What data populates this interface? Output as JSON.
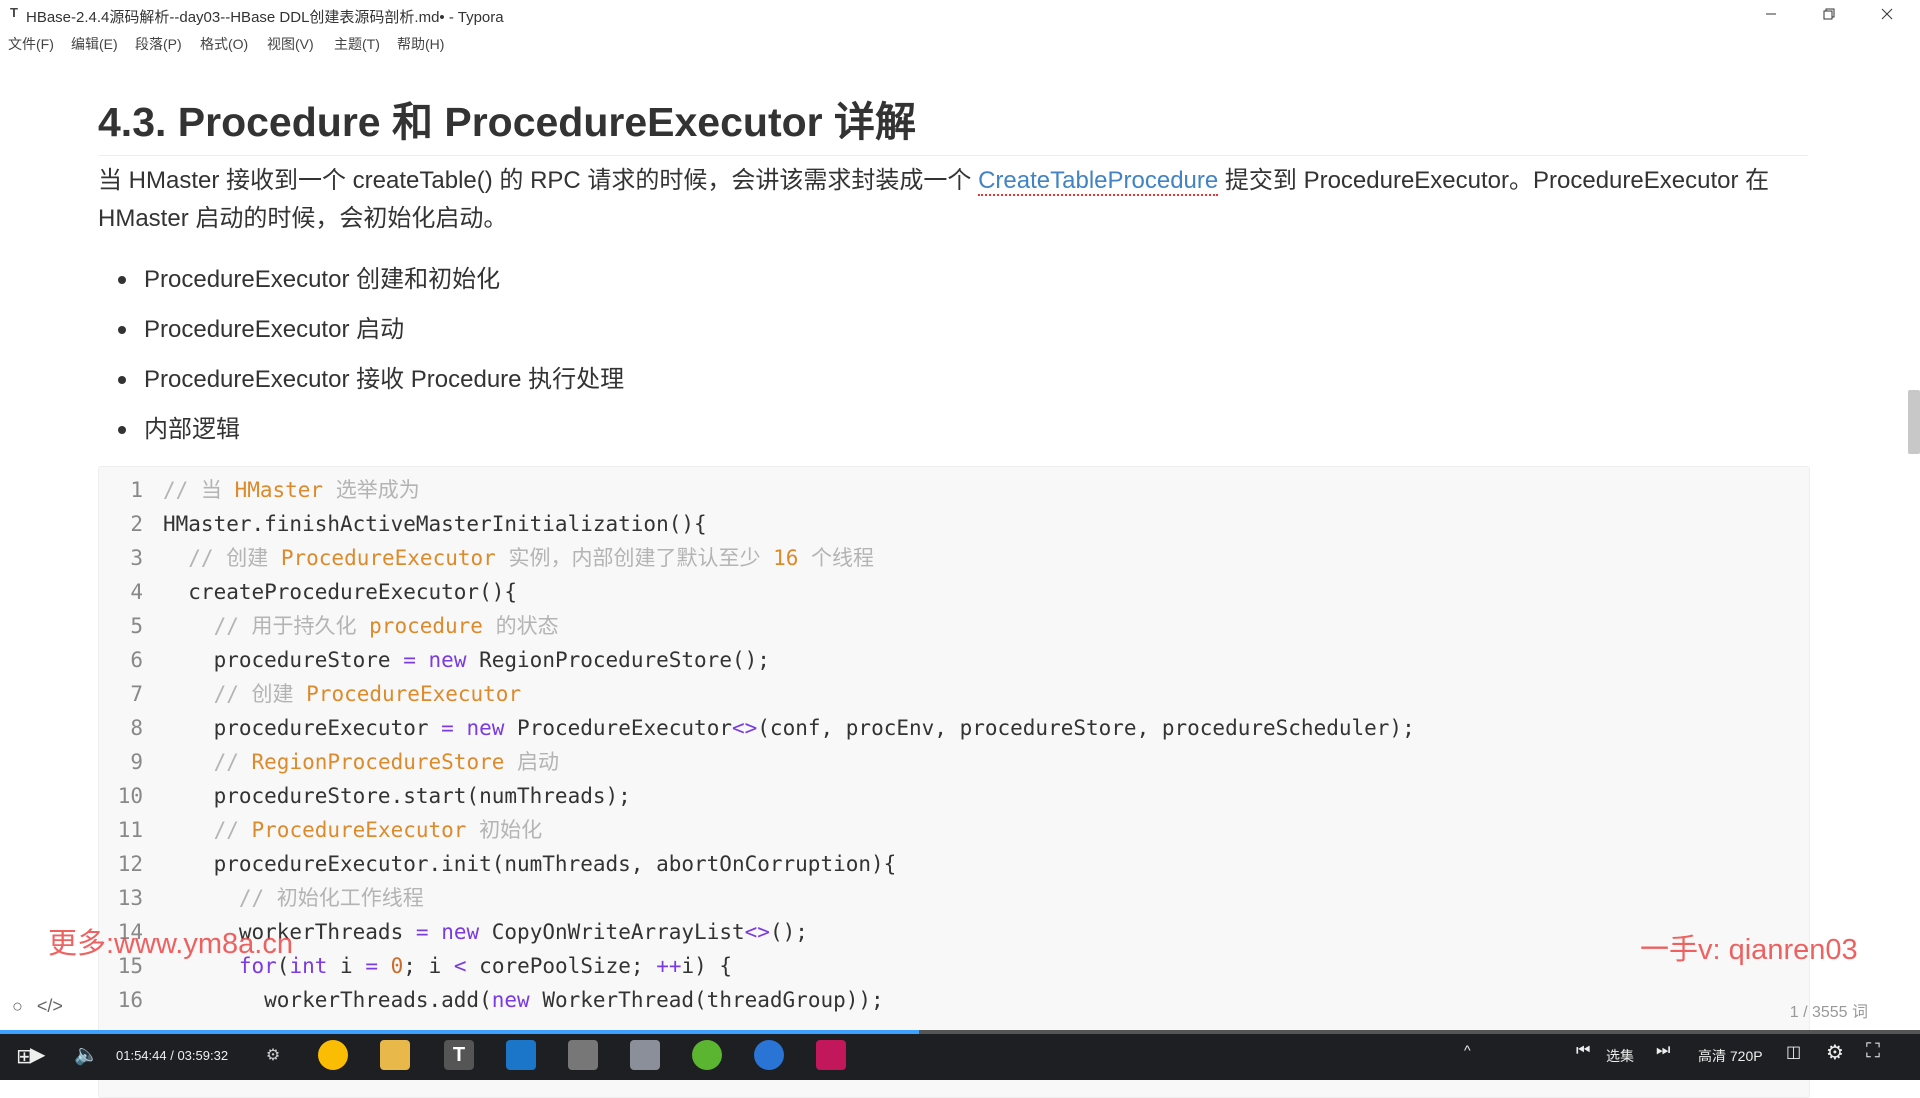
{
  "window": {
    "title": "HBase-2.4.4源码解析--day03--HBase DDL创建表源码剖析.md• - Typora",
    "app_icon": "T"
  },
  "menu": [
    "文件(F)",
    "编辑(E)",
    "段落(P)",
    "格式(O)",
    "视图(V)",
    "主题(T)",
    "帮助(H)"
  ],
  "doc": {
    "heading": "4.3. Procedure 和 ProcedureExecutor 详解",
    "para_before": "当 HMaster 接收到一个 createTable() 的 RPC 请求的时候，会讲该需求封装成一个 ",
    "para_link": "CreateTableProcedure",
    "para_after": " 提交到 ProcedureExecutor。ProcedureExecutor 在 HMaster 启动的时候，会初始化启动。",
    "bullets": [
      "ProcedureExecutor 创建和初始化",
      "ProcedureExecutor 启动",
      "ProcedureExecutor 接收 Procedure 执行处理",
      "内部逻辑"
    ],
    "code_lines": [
      [
        [
          "// 当 ",
          "c"
        ],
        [
          "HMaster",
          "ck"
        ],
        [
          " 选举成为",
          "c"
        ]
      ],
      [
        [
          "HMaster.finishActiveMasterInitialization(){",
          "p"
        ]
      ],
      [
        [
          "  // 创建 ",
          "c"
        ],
        [
          "ProcedureExecutor",
          "ck"
        ],
        [
          " 实例，内部创建了默认至少 ",
          "c"
        ],
        [
          "16",
          "ck"
        ],
        [
          " 个线程",
          "c"
        ]
      ],
      [
        [
          "  createProcedureExecutor(){",
          "p"
        ]
      ],
      [
        [
          "    // 用于持久化 ",
          "c"
        ],
        [
          "procedure",
          "ck"
        ],
        [
          " 的状态",
          "c"
        ]
      ],
      [
        [
          "    procedureStore ",
          "p"
        ],
        [
          "=",
          "k"
        ],
        [
          " ",
          "p"
        ],
        [
          "new",
          "k"
        ],
        [
          " RegionProcedureStore();",
          "p"
        ]
      ],
      [
        [
          "    // 创建 ",
          "c"
        ],
        [
          "ProcedureExecutor",
          "ck"
        ]
      ],
      [
        [
          "    procedureExecutor ",
          "p"
        ],
        [
          "=",
          "k"
        ],
        [
          " ",
          "p"
        ],
        [
          "new",
          "k"
        ],
        [
          " ProcedureExecutor",
          "p"
        ],
        [
          "<>",
          "k"
        ],
        [
          "(conf, procEnv, procedureStore, procedureScheduler);",
          "p"
        ]
      ],
      [
        [
          "    // ",
          "c"
        ],
        [
          "RegionProcedureStore",
          "ck"
        ],
        [
          " 启动",
          "c"
        ]
      ],
      [
        [
          "    procedureStore.start(numThreads);",
          "p"
        ]
      ],
      [
        [
          "    // ",
          "c"
        ],
        [
          "ProcedureExecutor",
          "ck"
        ],
        [
          " 初始化",
          "c"
        ]
      ],
      [
        [
          "    procedureExecutor.init(numThreads, abortOnCorruption){",
          "p"
        ]
      ],
      [
        [
          "      // 初始化工作线程",
          "c"
        ]
      ],
      [
        [
          "      workerThreads ",
          "p"
        ],
        [
          "=",
          "k"
        ],
        [
          " ",
          "p"
        ],
        [
          "new",
          "k"
        ],
        [
          " CopyOnWriteArrayList",
          "p"
        ],
        [
          "<>",
          "k"
        ],
        [
          "();",
          "p"
        ]
      ],
      [
        [
          "      ",
          "p"
        ],
        [
          "for",
          "k"
        ],
        [
          "(",
          "p"
        ],
        [
          "int",
          "k"
        ],
        [
          " i ",
          "p"
        ],
        [
          "=",
          "k"
        ],
        [
          " ",
          "p"
        ],
        [
          "0",
          "n"
        ],
        [
          "; i ",
          "p"
        ],
        [
          "<",
          "k"
        ],
        [
          " corePoolSize; ",
          "p"
        ],
        [
          "++",
          "k"
        ],
        [
          "i) {",
          "p"
        ]
      ],
      [
        [
          "        workerThreads.add(",
          "p"
        ],
        [
          "new",
          "k"
        ],
        [
          " WorkerThread(threadGroup));",
          "p"
        ]
      ]
    ],
    "word_count": "1 / 3555 词"
  },
  "watermarks": {
    "left": "更多:www.ym8a.cn",
    "right": "一手v: qianren03"
  },
  "player": {
    "time": "01:54:44 / 03:59:32",
    "progress_fraction": 0.4789,
    "episodes_label": "选集",
    "quality_label": "高清 720P"
  },
  "taskbar_icons": [
    "chrome-icon",
    "folder-icon",
    "typora-icon",
    "app-icon-blue",
    "app-icon-grey",
    "app-icon-doc",
    "app-icon-green",
    "app-icon-blue-2",
    "intellij-icon"
  ],
  "colors": {
    "link": "#4183c4",
    "keyword": "#7a3be0",
    "comment": "#b4b4b4",
    "comment_keyword": "#dc8a2b",
    "watermark": "#eb4646",
    "progress": "#3ea1ff"
  }
}
